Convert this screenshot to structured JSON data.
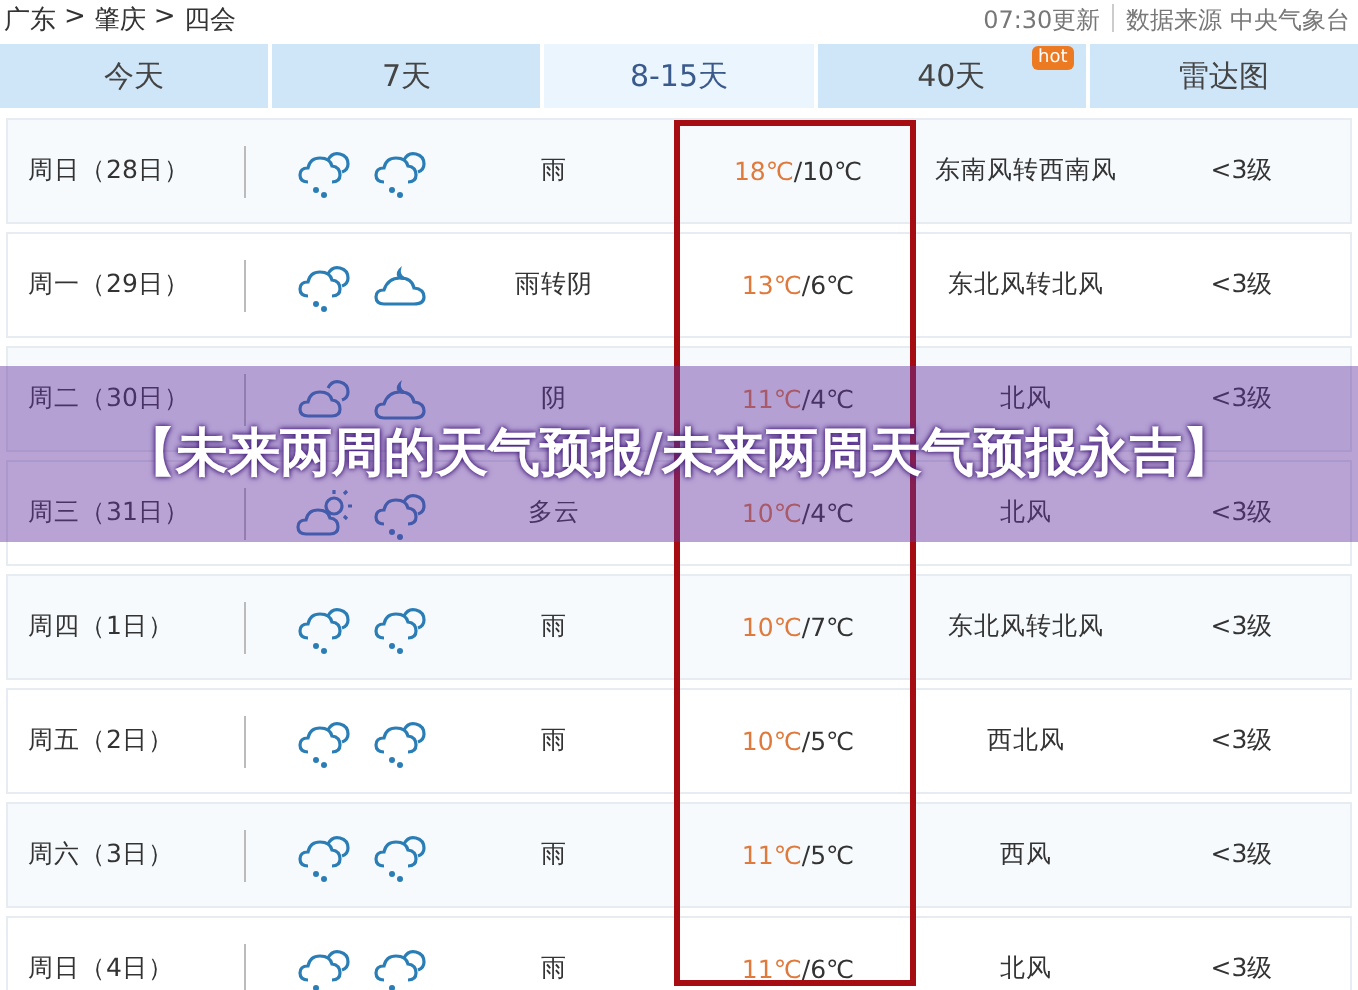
{
  "breadcrumb": [
    "广东",
    ">",
    "肇庆",
    ">",
    "四会"
  ],
  "update_time": "07:30更新",
  "source": "数据来源 中央气象台",
  "tabs": [
    {
      "label": "今天",
      "selected": false
    },
    {
      "label": "7天",
      "selected": false
    },
    {
      "label": "8-15天",
      "selected": true
    },
    {
      "label": "40天",
      "selected": false,
      "badge": "hot"
    },
    {
      "label": "雷达图",
      "selected": false
    }
  ],
  "rows": [
    {
      "date": "周日（28日）",
      "icons": [
        {
          "kind": "rain"
        },
        {
          "kind": "rain"
        }
      ],
      "weather": "雨",
      "high": "18℃",
      "low": "/10℃",
      "wind": "东南风转西南风",
      "level": "<3级"
    },
    {
      "date": "周一（29日）",
      "icons": [
        {
          "kind": "rain"
        },
        {
          "kind": "cloud-moon"
        }
      ],
      "weather": "雨转阴",
      "high": "13℃",
      "low": "/6℃",
      "wind": "东北风转北风",
      "level": "<3级"
    },
    {
      "date": "周二（30日）",
      "icons": [
        {
          "kind": "cloud"
        },
        {
          "kind": "cloud-moon"
        }
      ],
      "weather": "阴",
      "high": "11℃",
      "low": "/4℃",
      "wind": "北风",
      "level": "<3级"
    },
    {
      "date": "周三（31日）",
      "icons": [
        {
          "kind": "sun-cloud"
        },
        {
          "kind": "rain"
        }
      ],
      "weather": "多云",
      "high": "10℃",
      "low": "/4℃",
      "wind": "北风",
      "level": "<3级"
    },
    {
      "date": "周四（1日）",
      "icons": [
        {
          "kind": "rain"
        },
        {
          "kind": "rain"
        }
      ],
      "weather": "雨",
      "high": "10℃",
      "low": "/7℃",
      "wind": "东北风转北风",
      "level": "<3级"
    },
    {
      "date": "周五（2日）",
      "icons": [
        {
          "kind": "rain"
        },
        {
          "kind": "rain"
        }
      ],
      "weather": "雨",
      "high": "10℃",
      "low": "/5℃",
      "wind": "西北风",
      "level": "<3级"
    },
    {
      "date": "周六（3日）",
      "icons": [
        {
          "kind": "rain"
        },
        {
          "kind": "rain"
        }
      ],
      "weather": "雨",
      "high": "11℃",
      "low": "/5℃",
      "wind": "西风",
      "level": "<3级"
    },
    {
      "date": "周日（4日）",
      "icons": [
        {
          "kind": "rain"
        },
        {
          "kind": "rain"
        }
      ],
      "weather": "雨",
      "high": "11℃",
      "low": "/6℃",
      "wind": "北风",
      "level": "<3级"
    }
  ],
  "banner": "【未来两周的天气预报/未来两周天气预报永吉】"
}
